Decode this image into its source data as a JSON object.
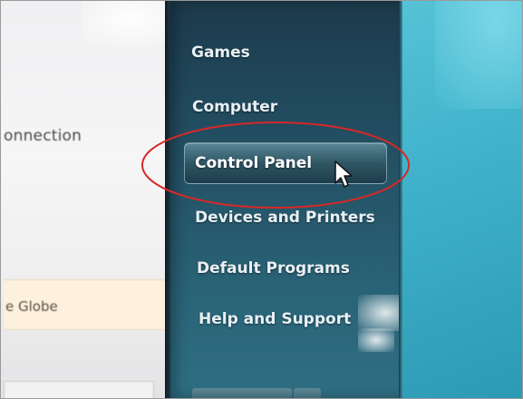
{
  "left_window": {
    "connection_text": "onnection",
    "globe_text": "e Globe"
  },
  "start_menu": {
    "items": [
      {
        "label": "Games"
      },
      {
        "label": "Computer"
      },
      {
        "label": "Control Panel",
        "highlighted": true
      },
      {
        "label": "Devices and Printers"
      },
      {
        "label": "Default Programs"
      },
      {
        "label": "Help and Support"
      }
    ]
  },
  "annotation": {
    "shape": "ellipse",
    "color": "#d82828",
    "target": "Control Panel"
  },
  "colors": {
    "start_pane": "#24506a",
    "desktop": "#45b6cd",
    "highlight": "#3e6f80",
    "menu_text": "#e8f0f4"
  },
  "icons": {
    "pointer": "mouse-cursor-arrow-icon"
  }
}
